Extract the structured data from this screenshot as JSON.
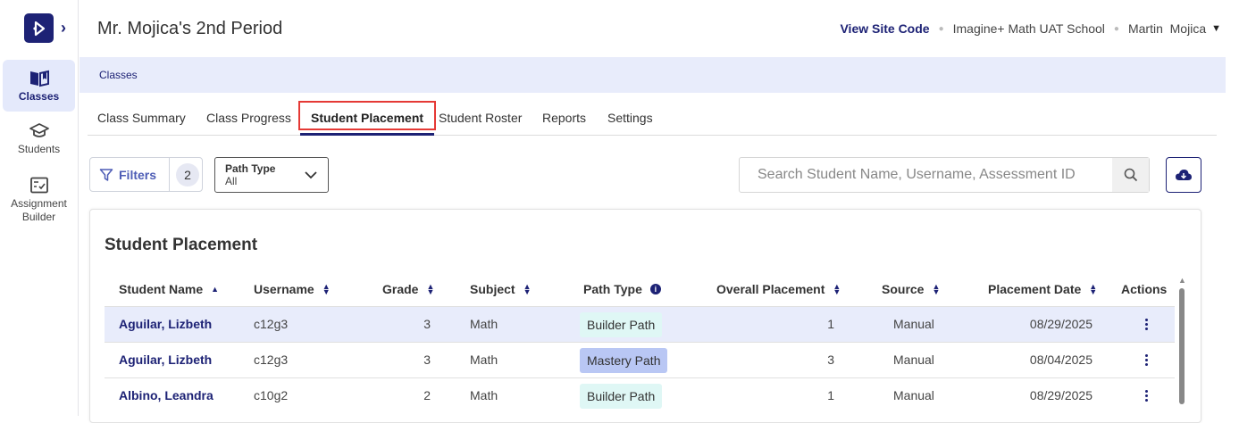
{
  "sidebar": {
    "items": [
      {
        "label": "Classes",
        "icon": "book-icon",
        "active": true
      },
      {
        "label": "Students",
        "icon": "graduation-cap-icon",
        "active": false
      },
      {
        "label": "Assignment Builder",
        "icon": "checklist-icon",
        "active": false
      }
    ]
  },
  "header": {
    "title": "Mr. Mojica's 2nd Period",
    "site_code": "View Site Code",
    "school": "Imagine+ Math UAT School",
    "user": "Martin  Mojica"
  },
  "breadcrumb": "Classes",
  "tabs": [
    "Class Summary",
    "Class Progress",
    "Student Placement",
    "Student Roster",
    "Reports",
    "Settings"
  ],
  "active_tab": "Student Placement",
  "toolbar": {
    "filters_label": "Filters",
    "filters_count": "2",
    "path_type_label": "Path Type",
    "path_type_value": "All",
    "search_placeholder": "Search Student Name, Username, Assessment ID"
  },
  "table": {
    "title": "Student Placement",
    "columns": [
      "Student Name",
      "Username",
      "Grade",
      "Subject",
      "Path Type",
      "Overall Placement",
      "Source",
      "Placement Date",
      "Actions"
    ],
    "rows": [
      {
        "name": "Aguilar, Lizbeth",
        "username": "c12g3",
        "grade": "3",
        "subject": "Math",
        "path": "Builder Path",
        "placement": "1",
        "source": "Manual",
        "date": "08/29/2025"
      },
      {
        "name": "Aguilar, Lizbeth",
        "username": "c12g3",
        "grade": "3",
        "subject": "Math",
        "path": "Mastery Path",
        "placement": "3",
        "source": "Manual",
        "date": "08/04/2025"
      },
      {
        "name": "Albino, Leandra",
        "username": "c10g2",
        "grade": "2",
        "subject": "Math",
        "path": "Builder Path",
        "placement": "1",
        "source": "Manual",
        "date": "08/29/2025"
      }
    ]
  },
  "colors": {
    "brand": "#1d2275",
    "highlight": "#e53935",
    "builder_pill": "#dff7f5",
    "mastery_pill": "#b9c7f4"
  }
}
